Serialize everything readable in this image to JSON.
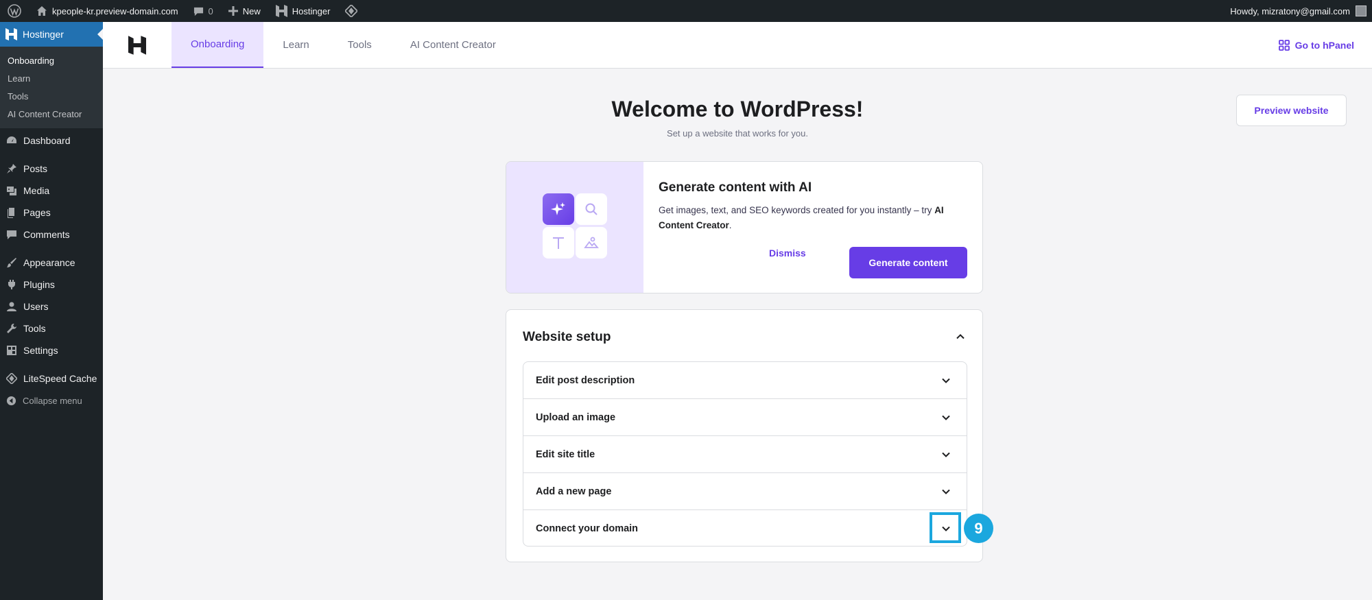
{
  "adminbar": {
    "site_name": "kpeople-kr.preview-domain.com",
    "comments_count": "0",
    "new_label": "New",
    "hostinger_label": "Hostinger",
    "howdy": "Howdy, mizratony@gmail.com"
  },
  "sidebar": {
    "current": "Hostinger",
    "submenu": [
      "Onboarding",
      "Learn",
      "Tools",
      "AI Content Creator"
    ],
    "items": {
      "dashboard": "Dashboard",
      "posts": "Posts",
      "media": "Media",
      "pages": "Pages",
      "comments": "Comments",
      "appearance": "Appearance",
      "plugins": "Plugins",
      "users": "Users",
      "tools": "Tools",
      "settings": "Settings",
      "litespeed": "LiteSpeed Cache",
      "collapse": "Collapse menu"
    }
  },
  "topnav": {
    "tabs": [
      "Onboarding",
      "Learn",
      "Tools",
      "AI Content Creator"
    ],
    "active_tab": "Onboarding",
    "hpanel": "Go to hPanel"
  },
  "main": {
    "title": "Welcome to WordPress!",
    "subtitle": "Set up a website that works for you.",
    "preview_button": "Preview website"
  },
  "ai_card": {
    "title": "Generate content with AI",
    "desc_prefix": "Get images, text, and SEO keywords created for you instantly – try ",
    "desc_bold": "AI Content Creator",
    "desc_suffix": ".",
    "dismiss": "Dismiss",
    "generate": "Generate content"
  },
  "setup": {
    "title": "Website setup",
    "tasks": [
      "Edit post description",
      "Upload an image",
      "Edit site title",
      "Add a new page",
      "Connect your domain"
    ]
  },
  "annotation": {
    "badge": "9"
  },
  "colors": {
    "brand_purple": "#673de6",
    "wp_blue": "#2271b1",
    "annotation": "#1ba7de"
  }
}
